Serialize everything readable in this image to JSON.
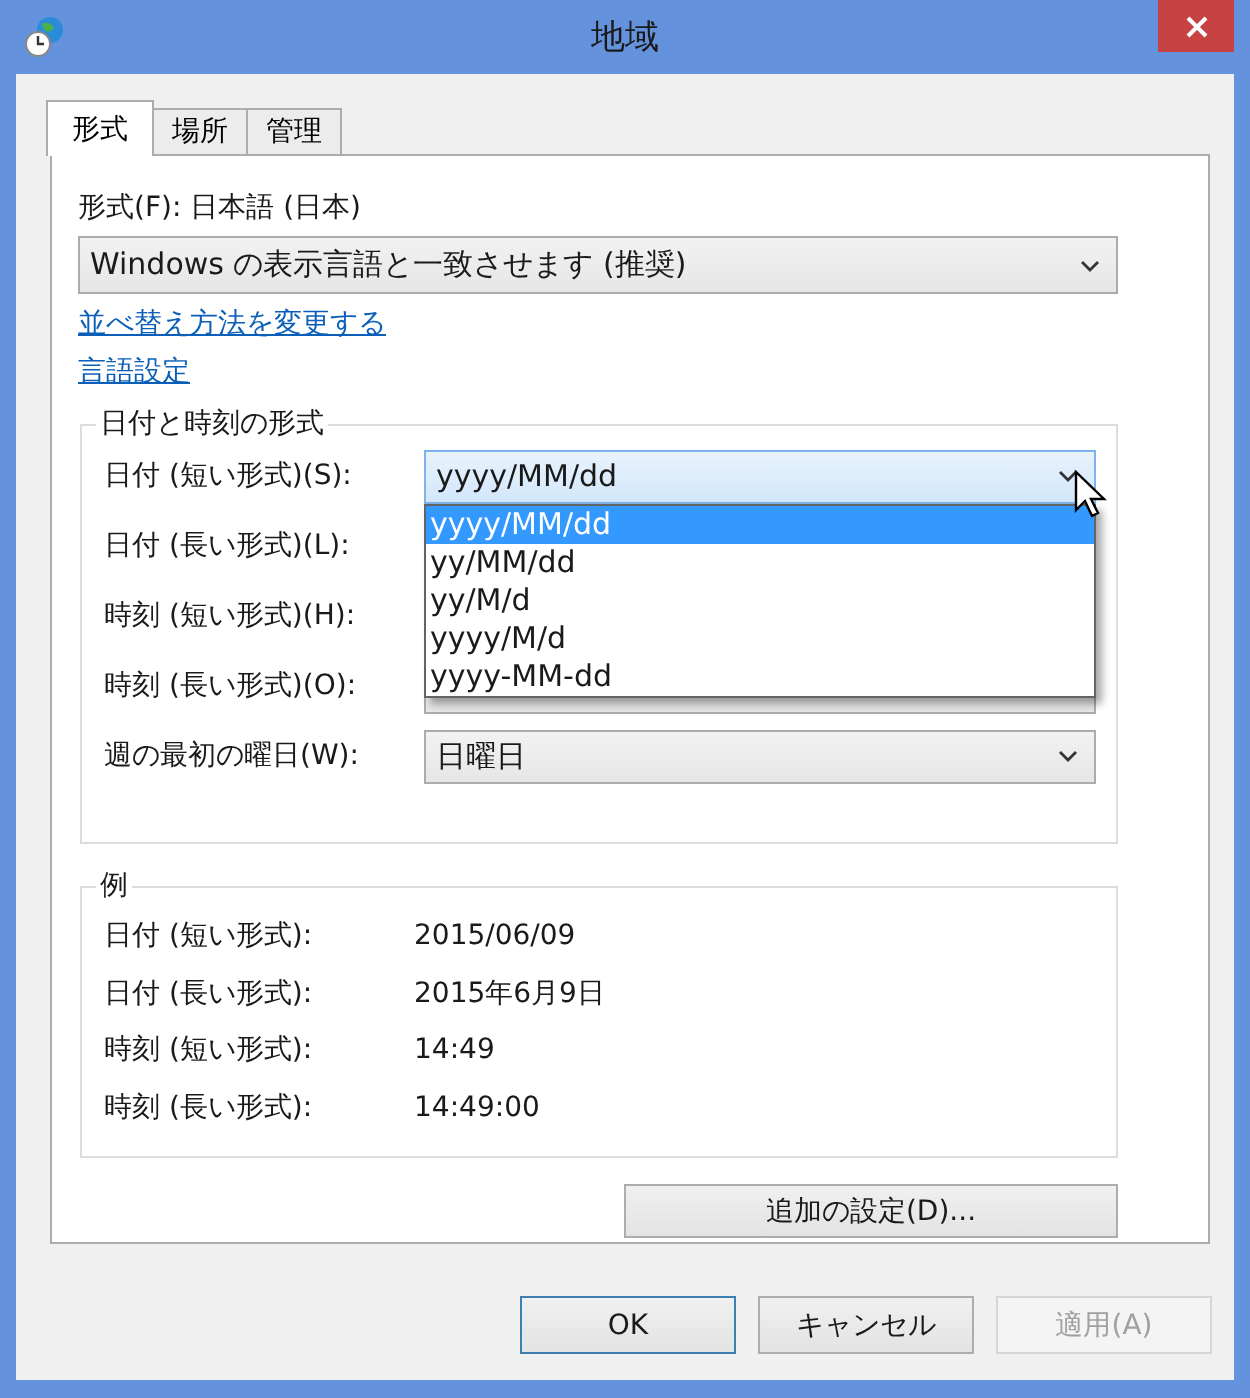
{
  "window": {
    "title": "地域"
  },
  "tabs": [
    {
      "label": "形式",
      "selected": true
    },
    {
      "label": "場所",
      "selected": false
    },
    {
      "label": "管理",
      "selected": false
    }
  ],
  "format": {
    "label": "形式(F): 日本語 (日本)",
    "value": "Windows の表示言語と一致させます (推奨)"
  },
  "links": [
    "並べ替え方法を変更する",
    "言語設定"
  ],
  "date_time_formats": {
    "title": "日付と時刻の形式",
    "rows": [
      {
        "label": "日付 (短い形式)(S):",
        "value": "yyyy/MM/dd",
        "expanded": true,
        "options": [
          {
            "label": "yyyy/MM/dd",
            "selected": true
          },
          {
            "label": "yy/MM/dd",
            "selected": false
          },
          {
            "label": "yy/M/d",
            "selected": false
          },
          {
            "label": "yyyy/M/d",
            "selected": false
          },
          {
            "label": "yyyy-MM-dd",
            "selected": false
          }
        ]
      },
      {
        "label": "日付 (長い形式)(L):"
      },
      {
        "label": "時刻 (短い形式)(H):"
      },
      {
        "label": "時刻 (長い形式)(O):",
        "expanded": false
      },
      {
        "label": "週の最初の曜日(W):",
        "value": "日曜日",
        "expanded": false
      }
    ]
  },
  "examples": {
    "title": "例",
    "rows": [
      {
        "label": "日付 (短い形式):",
        "value": "2015/06/09"
      },
      {
        "label": "日付 (長い形式):",
        "value": "2015年6月9日"
      },
      {
        "label": "時刻 (短い形式):",
        "value": "14:49"
      },
      {
        "label": "時刻 (長い形式):",
        "value": "14:49:00"
      }
    ]
  },
  "additional_button": "追加の設定(D)...",
  "buttons": [
    {
      "label": "OK",
      "disabled": false,
      "default": true
    },
    {
      "label": "キャンセル",
      "disabled": false,
      "default": false
    },
    {
      "label": "適用(A)",
      "disabled": true,
      "default": false
    }
  ]
}
